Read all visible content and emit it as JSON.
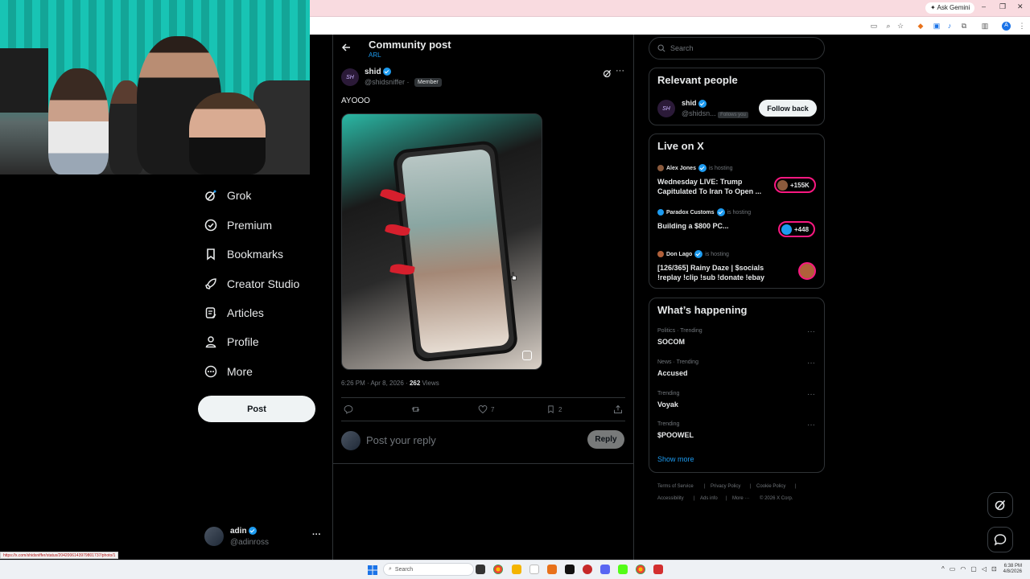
{
  "browser": {
    "ask_gemini": "Ask Gemini"
  },
  "nav": {
    "items": [
      {
        "label": "Grok",
        "icon": "grok-icon"
      },
      {
        "label": "Premium",
        "icon": "premium-icon"
      },
      {
        "label": "Bookmarks",
        "icon": "bookmark-icon"
      },
      {
        "label": "Creator Studio",
        "icon": "rocket-icon"
      },
      {
        "label": "Articles",
        "icon": "articles-icon"
      },
      {
        "label": "Profile",
        "icon": "profile-icon"
      },
      {
        "label": "More",
        "icon": "more-circle-icon"
      }
    ],
    "post_label": "Post",
    "account": {
      "name": "adin",
      "handle": "@adinross",
      "more": "···"
    }
  },
  "header": {
    "title": "Community post",
    "subtitle": "ARL"
  },
  "post": {
    "avatar_text": "SH",
    "author": "shid",
    "handle": "@shidsniffer",
    "separator": "·",
    "member_badge": "Member",
    "text": "AYOOO",
    "time": "6:26 PM · Apr 8, 2026 · ",
    "views_count": "262",
    "views_label": " Views",
    "likes": "7",
    "bookmarks": "2"
  },
  "reply": {
    "placeholder": "Post your reply",
    "button": "Reply"
  },
  "sidebar": {
    "search_placeholder": "Search",
    "relevant": {
      "title": "Relevant people",
      "name": "shid",
      "handle": "@shidsn...",
      "follows_you": "Follows you",
      "follow_button": "Follow back",
      "avatar_text": "SH"
    },
    "live": {
      "title": "Live on X",
      "hosting": "is hosting",
      "items": [
        {
          "host": "Alex Jones",
          "title1": "Wednesday LIVE: Trump",
          "title2": "Capitulated To Iran To Open ...",
          "count": "+155K"
        },
        {
          "host": "Paradox Customs",
          "title1": "Building a $800 PC...",
          "title2": "",
          "count": "+448"
        },
        {
          "host": "Don Lago",
          "title1": "[126/365] Rainy Daze | $socials",
          "title2": "!replay !clip !sub !donate !ebay",
          "count": ""
        }
      ]
    },
    "happening": {
      "title": "What’s happening",
      "trends": [
        {
          "meta": "Politics · Trending",
          "name": "SOCOM"
        },
        {
          "meta": "News · Trending",
          "name": "Accused"
        },
        {
          "meta": "Trending",
          "name": "Voyak"
        },
        {
          "meta": "Trending",
          "name": "$POOWEL"
        }
      ],
      "show_more": "Show more"
    },
    "footer": {
      "terms": "Terms of Service",
      "privacy": "Privacy Policy",
      "cookie": "Cookie Policy",
      "accessibility": "Accessibility",
      "ads": "Ads info",
      "more": "More ···",
      "copyright": "© 2026 X Corp."
    }
  },
  "status_url": "https://x.com/shidsniffer/status/2042006143979801737/photo/1",
  "taskbar": {
    "search": "Search",
    "time": "6:38 PM",
    "date": "4/8/2026"
  },
  "colors": {
    "accent": "#1d9bf0",
    "live": "#f91880",
    "background": "#000000",
    "border": "#2f3336"
  }
}
